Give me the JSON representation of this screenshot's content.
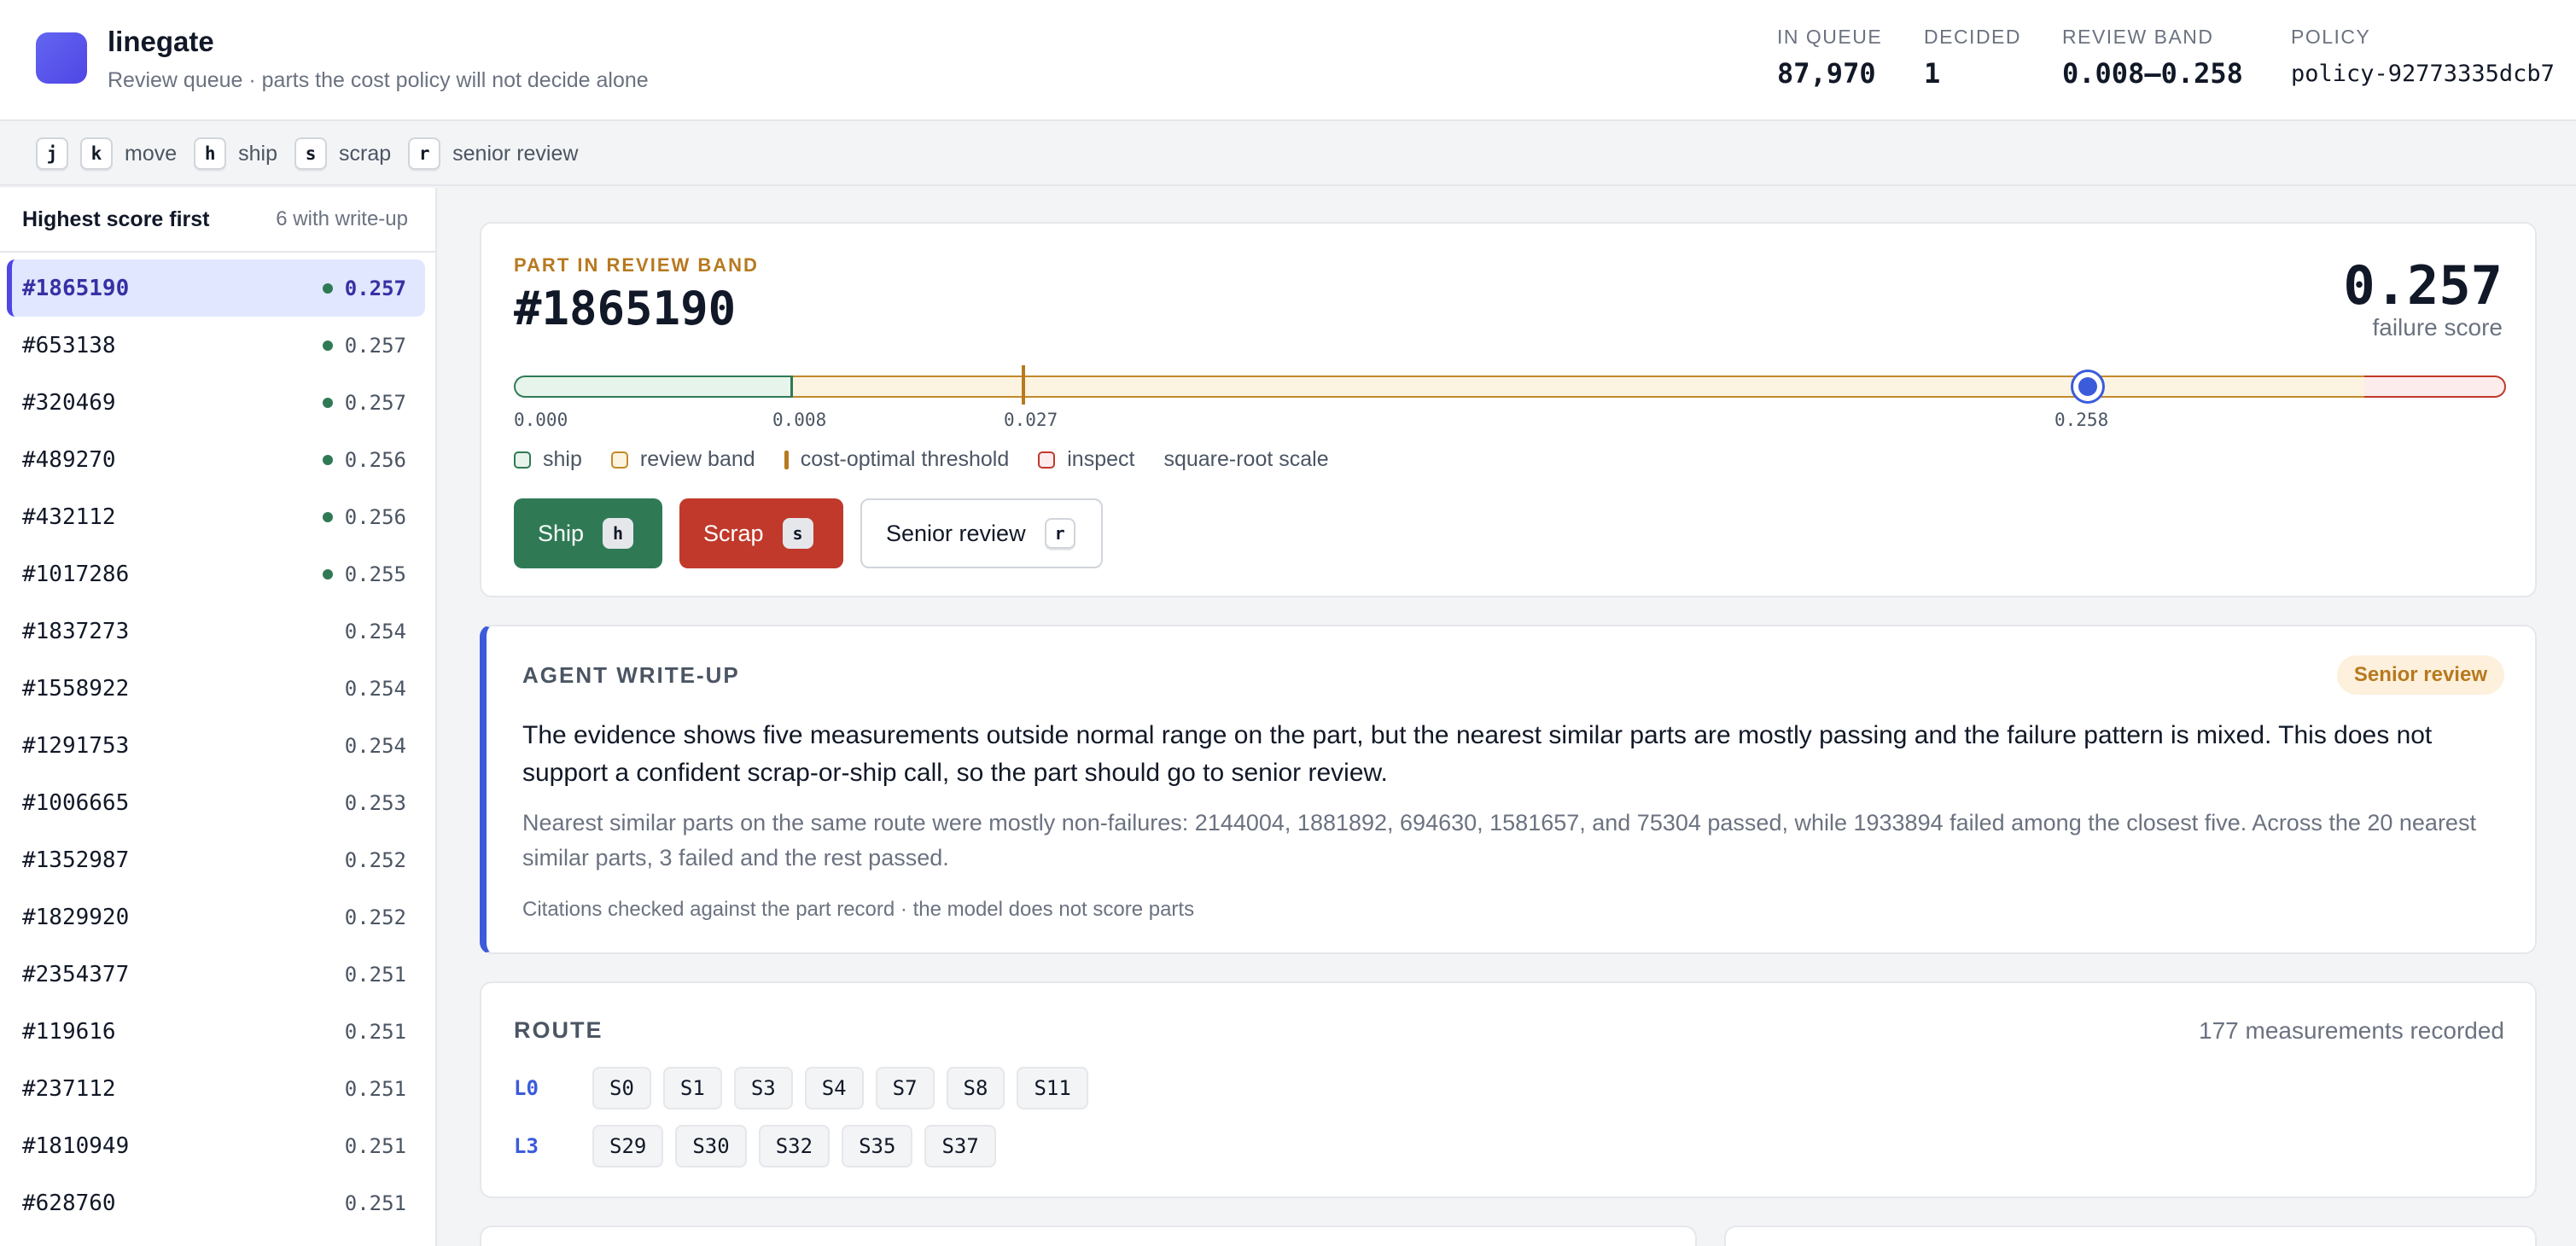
{
  "header": {
    "title": "linegate",
    "subtitle": "Review queue · parts the cost policy will not decide alone",
    "stats": [
      {
        "label": "IN QUEUE",
        "value": "87,970"
      },
      {
        "label": "DECIDED",
        "value": "1"
      },
      {
        "label": "REVIEW BAND",
        "value": "0.008–0.258"
      },
      {
        "label": "POLICY",
        "value": "policy-92773335dcb7"
      }
    ]
  },
  "shortcuts": {
    "keys": [
      "j",
      "k",
      "h",
      "s",
      "r"
    ],
    "labels": {
      "move": "move",
      "ship": "ship",
      "scrap": "scrap",
      "senior": "senior review"
    }
  },
  "sidebar": {
    "sort_label": "Highest score first",
    "writeup_count": "6 with write-up",
    "items": [
      {
        "id": "#1865190",
        "score": "0.257",
        "has_writeup": true,
        "active": true
      },
      {
        "id": "#653138",
        "score": "0.257",
        "has_writeup": true
      },
      {
        "id": "#320469",
        "score": "0.257",
        "has_writeup": true
      },
      {
        "id": "#489270",
        "score": "0.256",
        "has_writeup": true
      },
      {
        "id": "#432112",
        "score": "0.256",
        "has_writeup": true
      },
      {
        "id": "#1017286",
        "score": "0.255",
        "has_writeup": true
      },
      {
        "id": "#1837273",
        "score": "0.254",
        "has_writeup": false
      },
      {
        "id": "#1558922",
        "score": "0.254",
        "has_writeup": false
      },
      {
        "id": "#1291753",
        "score": "0.254",
        "has_writeup": false
      },
      {
        "id": "#1006665",
        "score": "0.253",
        "has_writeup": false
      },
      {
        "id": "#1352987",
        "score": "0.252",
        "has_writeup": false
      },
      {
        "id": "#1829920",
        "score": "0.252",
        "has_writeup": false
      },
      {
        "id": "#2354377",
        "score": "0.251",
        "has_writeup": false
      },
      {
        "id": "#119616",
        "score": "0.251",
        "has_writeup": false
      },
      {
        "id": "#237112",
        "score": "0.251",
        "has_writeup": false
      },
      {
        "id": "#1810949",
        "score": "0.251",
        "has_writeup": false
      },
      {
        "id": "#628760",
        "score": "0.251",
        "has_writeup": false
      }
    ]
  },
  "part": {
    "eyebrow": "PART IN REVIEW BAND",
    "id": "#1865190",
    "score": "0.257",
    "score_label": "failure score",
    "score_value": 0.257,
    "scale": {
      "ticks": [
        "0.000",
        "0.008",
        "0.027",
        "0.258"
      ],
      "ship_max": 0.008,
      "threshold": 0.027,
      "band_max": 0.258
    },
    "legend": {
      "ship": "ship",
      "band": "review band",
      "threshold": "cost-optimal threshold",
      "inspect": "inspect",
      "scale_note": "square-root scale"
    },
    "actions": {
      "ship": {
        "label": "Ship",
        "key": "h"
      },
      "scrap": {
        "label": "Scrap",
        "key": "s"
      },
      "senior": {
        "label": "Senior review",
        "key": "r"
      }
    }
  },
  "writeup": {
    "heading": "AGENT WRITE-UP",
    "badge": "Senior review",
    "summary": "The evidence shows five measurements outside normal range on the part, but the nearest similar parts are mostly passing and the failure pattern is mixed. This does not support a confident scrap-or-ship call, so the part should go to senior review.",
    "detail": "Nearest similar parts on the same route were mostly non-failures: 2144004, 1881892, 694630, 1581657, and 75304 passed, while 1933894 failed among the closest five. Across the 20 nearest similar parts, 3 failed and the rest passed.",
    "footnote": "Citations checked against the part record · the model does not score parts"
  },
  "route": {
    "heading": "ROUTE",
    "meta": "177 measurements recorded",
    "lines": [
      {
        "name": "L0",
        "stations": [
          "S0",
          "S1",
          "S3",
          "S4",
          "S7",
          "S8",
          "S11"
        ]
      },
      {
        "name": "L3",
        "stations": [
          "S29",
          "S30",
          "S32",
          "S35",
          "S37"
        ]
      }
    ]
  },
  "colors": {
    "accent": "#3b5bdb",
    "ship": "#2f7a55",
    "scrap": "#c0392b",
    "band": "#c08a2a",
    "senior_badge": "#b7791f"
  }
}
